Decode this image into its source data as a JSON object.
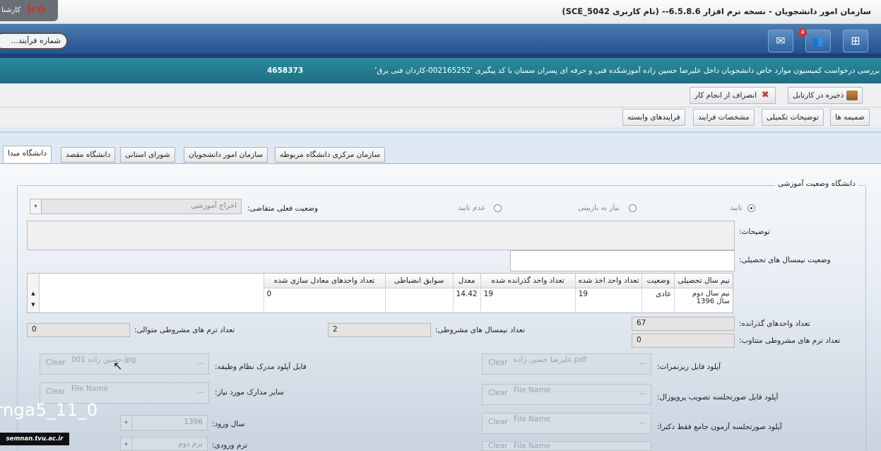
{
  "titlebar": {
    "title": "سازمان امور دانشجویان  -  نسخه نرم افزار  6.5.8.6--  (نام کاربری  SCE_5042)",
    "logo_text": "کارشنا"
  },
  "toolbar": {
    "process_number_placeholder": "شماره فرآیند...",
    "buttons": [
      {
        "name": "org-chart",
        "icon": "sitemap-icon",
        "glyph": "⊞"
      },
      {
        "name": "users",
        "icon": "users-icon",
        "glyph": "👥",
        "badge": "4"
      },
      {
        "name": "mail",
        "icon": "mail-icon",
        "glyph": "✉"
      }
    ]
  },
  "request": {
    "text": "بررسی درخواست کمیسیون موارد خاص دانشجویان داخل  علیرضا حسین زاده آموزشکده فنی و حرفه ای پسران سمنان با کد پیگیری   '002165252-کاردان فنی برق'",
    "number": "4658373"
  },
  "actions": {
    "save_to_cartable": "ذخیره در کارتابل",
    "cancel_task": "انصراف از انجام کار"
  },
  "process_tabs": [
    "ضمیمه ها",
    "توضیحات تکمیلی",
    "مشخصات فرایند",
    "فرایندهای وابسته"
  ],
  "org_tabs": [
    "دانشگاه مبدا",
    "دانشگاه مقصد",
    "شورای استانی",
    "سازمان امور دانشجویان",
    "سازمان مرکزی دانشگاه مربوطه"
  ],
  "form": {
    "legend": "دانشگاه وضعیت آموزشی",
    "radios": [
      {
        "label": "تایید",
        "checked": true
      },
      {
        "label": "نیاز به بازبینی",
        "checked": false
      },
      {
        "label": "عدم تایید",
        "checked": false
      }
    ],
    "applicant_status_label": "وضعیت فعلی متقاضی:",
    "applicant_status_value": "اخراج آموزشی",
    "description_label": "توضیحات:",
    "semester_status_label": "وضعیت نیمسال های تحصیلی:",
    "grid": {
      "headers": [
        "نیم سال تحصیلی",
        "وضعیت",
        "تعداد واحد اخذ شده",
        "تعداد واحد گذرانده شده",
        "معدل",
        "سوابق انضباطی",
        "تعداد واحدهای معادل سازی شده"
      ],
      "rows": [
        [
          "نیم سال دوم سال 1396",
          "عادی",
          "19",
          "19",
          "14.42",
          "",
          "0"
        ]
      ]
    },
    "passed_units_label": "تعداد واحدهای گذرانده:",
    "passed_units_value": "67",
    "consecutive_conditional_label": "تعداد ترم های مشروطی متناوب:",
    "consecutive_conditional_value": "0",
    "conditional_semesters_label": "تعداد نیمسال های مشروطی:",
    "conditional_semesters_value": "2",
    "sequential_conditional_label": "تعداد ترم های مشروطی متوالی:",
    "sequential_conditional_value": "0",
    "uploads": {
      "transcript_label": "آپلود فایل ریزنمرات:",
      "transcript_file": "علیرضا حسین زاده.pdf",
      "military_label": "فایل آپلود مدرک نظام وظیفه:",
      "military_file": "حسین زاده 001.jpg",
      "proposal_label": "آپلود فایل صورتجلسه تصویب پروپوزال:",
      "other_docs_label": "سایر مدارک مورد نیاز:",
      "phd_exam_label": "آپلود صورتجلسه آزمون جامع فقط دکترا:",
      "file_placeholder": "File Name",
      "clear": "Clear",
      "browse": "..."
    },
    "entry_year_label": "سال ورود:",
    "entry_year_value": "1396",
    "entry_term_label": "ترم ورودی:",
    "entry_term_value": "ترم دوم"
  },
  "overlay": {
    "watermark": "rnga5_11_0",
    "site": "semnan.tvu.ac.ir"
  }
}
